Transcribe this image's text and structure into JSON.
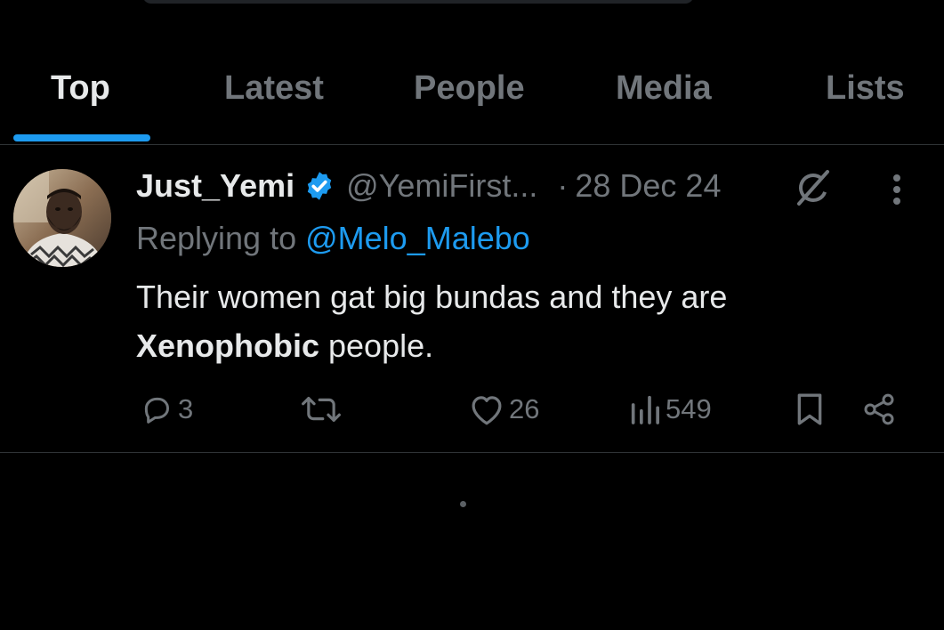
{
  "tabs": [
    {
      "label": "Top",
      "active": true
    },
    {
      "label": "Latest",
      "active": false
    },
    {
      "label": "People",
      "active": false
    },
    {
      "label": "Media",
      "active": false
    },
    {
      "label": "Lists",
      "active": false
    }
  ],
  "tweet": {
    "display_name": "Just_Yemi",
    "verified": true,
    "handle": "@YemiFirst...",
    "separator": "·",
    "date": "28 Dec 24",
    "reply_prefix": "Replying to",
    "reply_mention": "@Melo_Malebo",
    "text_part1": "Their women gat big bundas and they are",
    "text_bold": "Xenophobic",
    "text_part2": " people.",
    "icons": {
      "grok": "grok-icon",
      "more": "more-vertical-icon",
      "verified": "verified-badge-icon"
    },
    "actions": {
      "replies": "3",
      "reposts": "",
      "likes": "26",
      "views": "549"
    }
  },
  "colors": {
    "background": "#000000",
    "accent": "#1d9bf0",
    "text_primary": "#e7e9ea",
    "text_secondary": "#71767b",
    "divider": "#2f3336"
  }
}
